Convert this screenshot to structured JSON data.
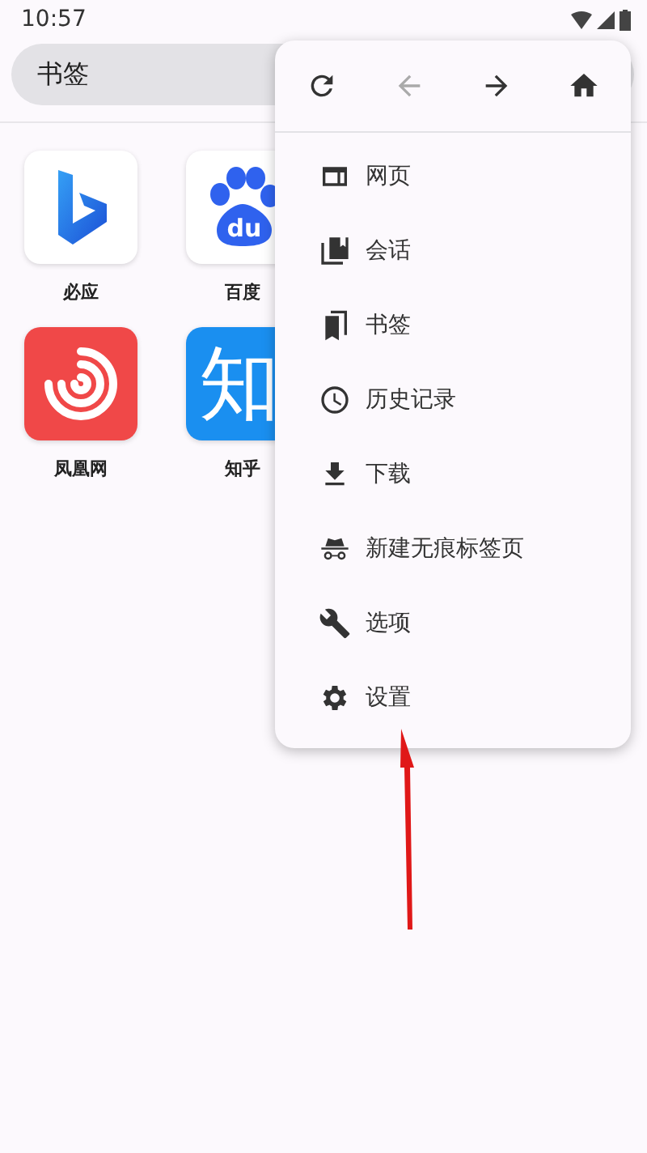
{
  "status_bar": {
    "time": "10:57"
  },
  "search": {
    "value": "书签"
  },
  "shortcuts": [
    {
      "label": "必应",
      "kind": "bing"
    },
    {
      "label": "百度",
      "kind": "baidu",
      "logo_text": "du"
    },
    {
      "label": "凤凰网",
      "kind": "ifeng"
    },
    {
      "label": "知乎",
      "kind": "zhihu",
      "logo_text": "知"
    }
  ],
  "menu": {
    "toolbar": [
      {
        "kind": "reload",
        "disabled": false
      },
      {
        "kind": "back",
        "disabled": true
      },
      {
        "kind": "forward",
        "disabled": false
      },
      {
        "kind": "home",
        "disabled": false
      }
    ],
    "items": [
      {
        "label": "网页",
        "kind": "tabs"
      },
      {
        "label": "会话",
        "kind": "sessions"
      },
      {
        "label": "书签",
        "kind": "bookmarks"
      },
      {
        "label": "历史记录",
        "kind": "history"
      },
      {
        "label": "下载",
        "kind": "download"
      },
      {
        "label": "新建无痕标签页",
        "kind": "incognito"
      },
      {
        "label": "选项",
        "kind": "options"
      },
      {
        "label": "设置",
        "kind": "settings"
      }
    ]
  }
}
